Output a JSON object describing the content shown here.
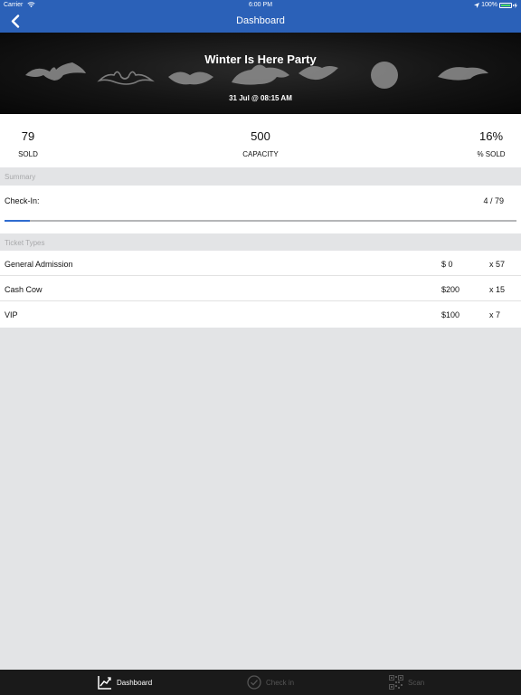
{
  "status_bar": {
    "carrier": "Carrier",
    "time": "6:00 PM",
    "battery": "100%",
    "icons": [
      "wifi-icon",
      "location-arrow-icon",
      "battery-icon"
    ]
  },
  "nav": {
    "title": "Dashboard",
    "back_icon": "chevron-left-icon"
  },
  "event": {
    "title": "Winter Is Here Party",
    "date": "31 Jul @ 08:15 AM"
  },
  "stats": {
    "sold": {
      "value": "79",
      "label": "SOLD"
    },
    "capacity": {
      "value": "500",
      "label": "CAPACITY"
    },
    "percent_sold": {
      "value": "16%",
      "label": "% SOLD"
    }
  },
  "summary": {
    "header": "Summary",
    "checkin_label": "Check-In:",
    "checkin_count": "4  / 79",
    "checkin_progress_fraction": 0.05
  },
  "ticket_types": {
    "header": "Ticket Types",
    "rows": [
      {
        "name": "General Admission",
        "price": "$ 0",
        "qty": "x 57"
      },
      {
        "name": "Cash Cow",
        "price": "$200",
        "qty": "x 15"
      },
      {
        "name": "VIP",
        "price": "$100",
        "qty": "x 7"
      }
    ]
  },
  "tabs": [
    {
      "label": "Dashboard",
      "icon": "chart-line-icon",
      "active": true
    },
    {
      "label": "Check in",
      "icon": "check-circle-icon",
      "active": false
    },
    {
      "label": "Scan",
      "icon": "qr-code-icon",
      "active": false
    }
  ],
  "colors": {
    "header_blue": "#2b61b8",
    "progress_blue": "#2f6cd0",
    "tab_bar": "#1a1a1a",
    "background": "#e3e4e6"
  }
}
